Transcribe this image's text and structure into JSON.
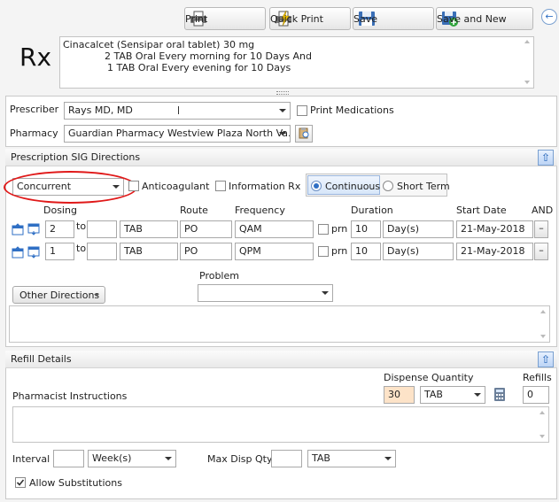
{
  "toolbar": {
    "print": "Print",
    "quick_print": "Quick Print",
    "save": "Save",
    "save_and_new": "Save and New"
  },
  "header": {
    "rx_label": "Rx",
    "summary_line1": "Cinacalcet (Sensipar oral tablet) 30 mg",
    "summary_line2": "2 TAB Oral Every morning for 10 Days And",
    "summary_line3": "1 TAB Oral Every evening for 10 Days"
  },
  "prescriber": {
    "label": "Prescriber",
    "value": "Rays MD, MD",
    "print_medications": "Print Medications"
  },
  "pharmacy": {
    "label": "Pharmacy",
    "value": "Guardian Pharmacy Westview Plaza North Va..."
  },
  "sig": {
    "section_title": "Prescription SIG Directions",
    "mode": "Concurrent",
    "anticoagulant": "Anticoagulant",
    "information_rx": "Information Rx",
    "continuous": "Continuous",
    "short_term": "Short Term",
    "headers": {
      "dosing": "Dosing",
      "route": "Route",
      "frequency": "Frequency",
      "duration": "Duration",
      "start_date": "Start Date",
      "and": "AND"
    },
    "rows": [
      {
        "dose": "2",
        "to": "to",
        "to_value": "",
        "unit": "TAB",
        "route": "PO",
        "frequency": "QAM",
        "prn": "prn",
        "duration": "10",
        "duration_unit": "Day(s)",
        "start_date": "21-May-2018",
        "remove": "–"
      },
      {
        "dose": "1",
        "to": "to",
        "to_value": "",
        "unit": "TAB",
        "route": "PO",
        "frequency": "QPM",
        "prn": "prn",
        "duration": "10",
        "duration_unit": "Day(s)",
        "start_date": "21-May-2018",
        "remove": "–"
      }
    ],
    "problem_label": "Problem",
    "problem_value": "",
    "other_directions": "Other Directions",
    "directions_text": ""
  },
  "refill": {
    "section_title": "Refill Details",
    "dispense_quantity_label": "Dispense Quantity",
    "refills_label": "Refills",
    "pharmacist_instructions": "Pharmacist Instructions",
    "dispense_quantity": "30",
    "dispense_unit": "TAB",
    "refills": "0",
    "instructions_text": "",
    "interval_label": "Interval",
    "interval_value": "",
    "interval_unit": "Week(s)",
    "max_disp_label": "Max Disp Qty",
    "max_disp_value": "",
    "max_disp_unit": "TAB",
    "allow_substitutions": "Allow Substitutions"
  },
  "colors": {
    "annotation_circle": "#e01919",
    "dispense_highlight": "#fde3c8",
    "accent_blue": "#2f6fc4"
  }
}
